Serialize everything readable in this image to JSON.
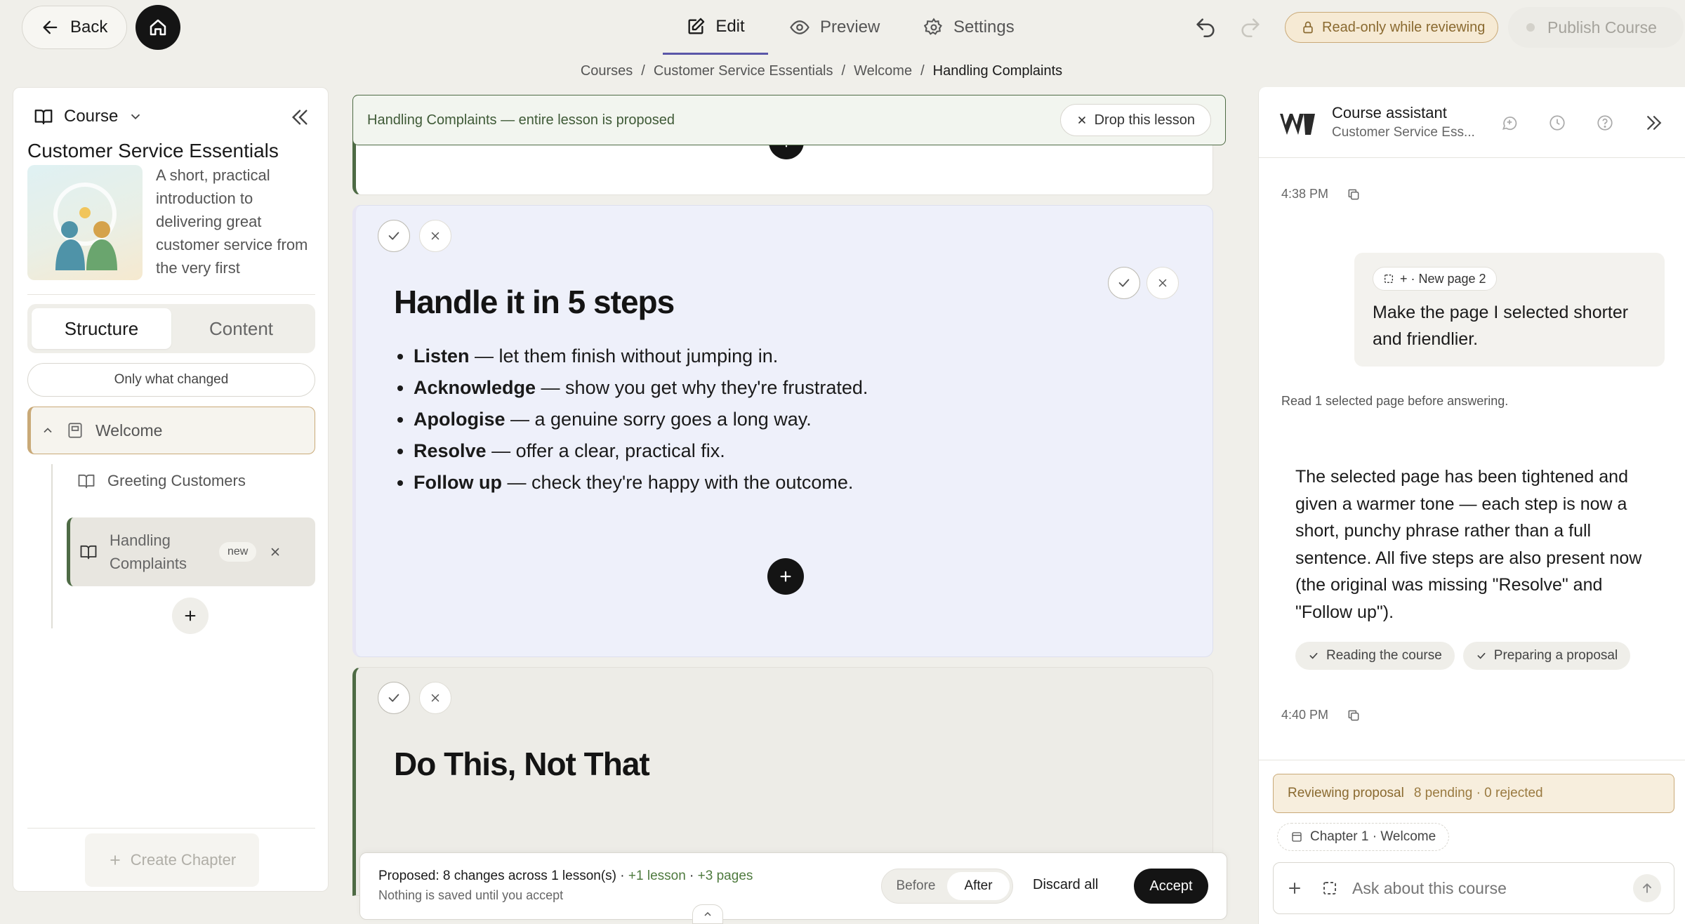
{
  "topbar": {
    "back_label": "Back",
    "tabs": [
      {
        "label": "Edit",
        "active": true
      },
      {
        "label": "Preview",
        "active": false
      },
      {
        "label": "Settings",
        "active": false
      }
    ],
    "readonly_badge": "Read-only while reviewing",
    "publish_label": "Publish Course"
  },
  "breadcrumb": [
    "Courses",
    "Customer Service Essentials",
    "Welcome",
    "Handling Complaints"
  ],
  "left": {
    "header_label": "Course",
    "course_title": "Customer Service Essentials",
    "course_desc": "A short, practical introduction to delivering great customer service from the very first",
    "tabs": [
      "Structure",
      "Content"
    ],
    "filter_label": "Only what changed",
    "chapter_label": "Welcome",
    "lessons": [
      {
        "label": "Greeting Customers"
      },
      {
        "label": "Handling Complaints",
        "badge": "new"
      }
    ],
    "create_chapter_label": "Create Chapter"
  },
  "center": {
    "banner_text": "Handling Complaints — entire lesson is proposed",
    "drop_label": "Drop this lesson",
    "page1": {
      "heading": "Handle it in 5 steps",
      "bullets": [
        {
          "bold": "Listen",
          "rest": " — let them finish without jumping in."
        },
        {
          "bold": "Acknowledge",
          "rest": " — show you get why they're frustrated."
        },
        {
          "bold": "Apologise",
          "rest": " — a genuine sorry goes a long way."
        },
        {
          "bold": "Resolve",
          "rest": " — offer a clear, practical fix."
        },
        {
          "bold": "Follow up",
          "rest": " — check they're happy with the outcome."
        }
      ]
    },
    "page2": {
      "heading": "Do This, Not That"
    },
    "footer": {
      "summary": "Proposed: 8 changes across 1 lesson(s) · ",
      "lesson_delta": "+1 lesson",
      "sep": " · ",
      "page_delta": "+3 pages",
      "note": "Nothing is saved until you accept",
      "before_label": "Before",
      "after_label": "After",
      "discard_label": "Discard all",
      "accept_label": "Accept"
    }
  },
  "assistant": {
    "title": "Course assistant",
    "subtitle": "Customer Service Ess...",
    "time1": "4:38 PM",
    "user_chip": "+ · New page 2",
    "user_message": "Make the page I selected shorter and friendlier.",
    "read_note": "Read 1 selected page before answering.",
    "reply": "The selected page has been tightened and given a warmer tone — each step is now a short, punchy phrase rather than a full sentence. All five steps are also present now (the original was missing \"Resolve\" and \"Follow up\").",
    "steps": [
      "Reading the course",
      "Preparing a proposal"
    ],
    "time2": "4:40 PM",
    "review_label": "Reviewing proposal",
    "review_counts": "8 pending · 0 rejected",
    "context_chip": "Chapter 1 · Welcome",
    "input_placeholder": "Ask about this course"
  },
  "colors": {
    "accent_green": "#4e6b45",
    "badge_amber": "#c9a977",
    "proposed_bg": "#eef0fa",
    "tab_underline": "#5a56a8"
  }
}
